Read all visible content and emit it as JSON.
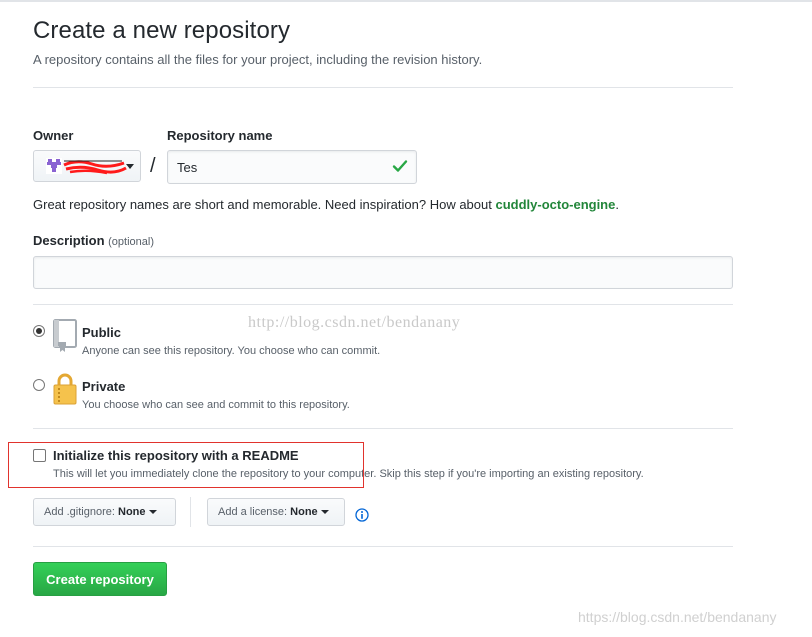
{
  "header": {
    "title": "Create a new repository",
    "description": "A repository contains all the files for your project, including the revision history."
  },
  "owner": {
    "label": "Owner"
  },
  "separator": "/",
  "repo_name": {
    "label": "Repository name",
    "value": "Tes"
  },
  "name_note": {
    "prefix": "Great repository names are short and memorable. Need inspiration? How about ",
    "suggestion": "cuddly-octo-engine",
    "suffix": "."
  },
  "description_field": {
    "label": "Description",
    "optional": "(optional)",
    "value": ""
  },
  "visibility": {
    "public": {
      "title": "Public",
      "desc": "Anyone can see this repository. You choose who can commit.",
      "selected": true
    },
    "private": {
      "title": "Private",
      "desc": "You choose who can see and commit to this repository.",
      "selected": false
    }
  },
  "readme": {
    "label": "Initialize this repository with a README",
    "desc": "This will let you immediately clone the repository to your computer. Skip this step if you're importing an existing repository.",
    "checked": false
  },
  "gitignore": {
    "prefix": "Add .gitignore:",
    "value": "None"
  },
  "license": {
    "prefix": "Add a license:",
    "value": "None"
  },
  "submit": {
    "label": "Create repository"
  },
  "watermarks": {
    "center": "http://blog.csdn.net/bendanany",
    "corner": "https://blog.csdn.net/bendanany"
  },
  "colors": {
    "primary_button": "#28a745",
    "suggestion": "#22863a",
    "annotation_box": "#e1332d",
    "info_icon": "#0366d6"
  }
}
